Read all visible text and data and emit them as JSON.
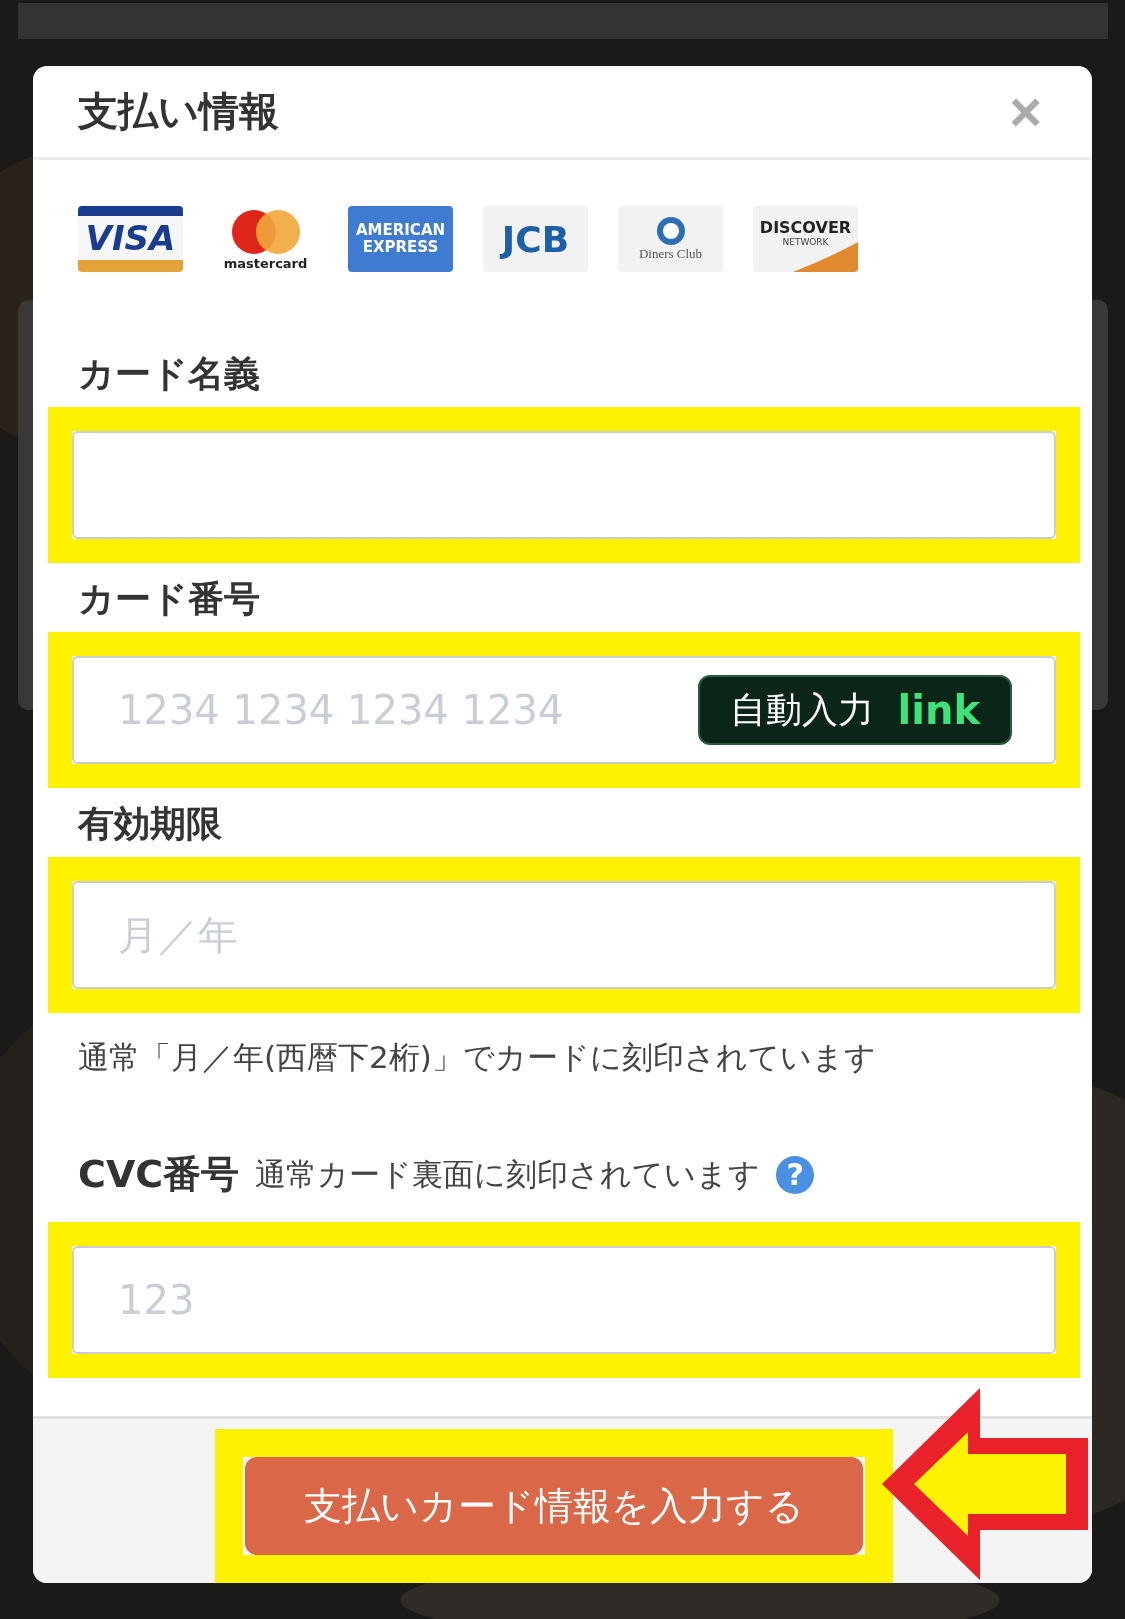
{
  "dialog": {
    "title": "支払い情報",
    "close": "×"
  },
  "card_brands": [
    {
      "kind": "visa",
      "text": "VISA"
    },
    {
      "kind": "mastercard",
      "text": "mastercard"
    },
    {
      "kind": "amex",
      "text": "AMERICAN EXPRESS"
    },
    {
      "kind": "jcb",
      "text": "JCB"
    },
    {
      "kind": "diners",
      "text": "Diners Club"
    },
    {
      "kind": "discover",
      "text": "DISCOVER",
      "subtext": "NETWORK"
    }
  ],
  "fields": [
    {
      "kind": "name",
      "label": "カード名義",
      "highlighted": true
    },
    {
      "kind": "number",
      "label": "カード番号",
      "placeholder": "1234 1234 1234 1234",
      "autofill": {
        "text": "自動入力",
        "brand": "link"
      },
      "highlighted": true
    },
    {
      "kind": "expiry",
      "label": "有効期限",
      "placeholder": "月／年",
      "hint": "通常「月／年(西暦下2桁)」でカードに刻印されています",
      "highlighted": true
    },
    {
      "kind": "cvc",
      "label": "CVC番号",
      "note": "通常カード裏面に刻印されています",
      "help": "?",
      "placeholder": "123",
      "highlighted": true
    }
  ],
  "submit": {
    "label": "支払いカード情報を入力する",
    "highlighted": true
  },
  "annotation_arrow": {
    "color": "#e8212b"
  }
}
